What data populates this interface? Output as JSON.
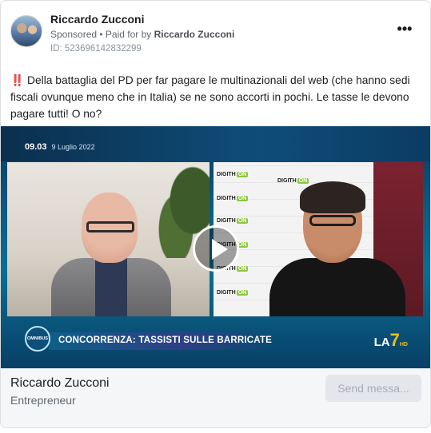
{
  "post": {
    "page_name": "Riccardo Zucconi",
    "sponsored": "Sponsored",
    "paid_for_prefix": " • Paid for by ",
    "payer": "Riccardo Zucconi",
    "ad_id": "ID: 523696142832299",
    "more_icon": "•••",
    "body_text": "‼️ Della battaglia del PD per far pagare le multinazionali del web (che hanno sedi fiscali ovunque meno che in Italia) se ne sono accorti in pochi. Le tasse le devono pagare tutti! O no?"
  },
  "video": {
    "time": "09.03",
    "date": "9 Luglio 2022",
    "omnibus_label": "OMNIBUS",
    "headline": "CONCORRENZA: TASSISTI SULLE BARRICATE",
    "channel_prefix": "LA",
    "channel_number": "7",
    "channel_suffix": "HD",
    "logo_text": "DIGITH",
    "logo_on": "ON",
    "play_icon": "play-icon"
  },
  "footer": {
    "name": "Riccardo Zucconi",
    "category": "Entrepreneur",
    "send_label": "Send messa..."
  }
}
